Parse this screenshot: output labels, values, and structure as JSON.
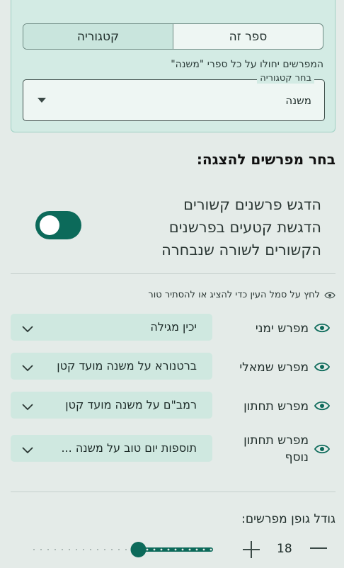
{
  "scope": {
    "segments": [
      "ספר זה",
      "קטגוריה"
    ],
    "active_segment": "קטגוריה",
    "note": "המפרשים יחולו על כל ספרי \"משנה\"",
    "select_label": "בחר קטגוריה",
    "select_value": "משנה"
  },
  "section_title": "בחר מפרשים להצגה:",
  "highlight_toggle": {
    "lines": [
      "הדגש פרשנים קשורים",
      "הדגשת קטעים בפרשנים",
      "הקשורים לשורה שנבחרה"
    ],
    "enabled": true
  },
  "eye_hint": "לחץ על סמל העין כדי להציג או להסתיר טור",
  "commentators": [
    {
      "label": "מפרש ימני",
      "value": "יכין מגילה"
    },
    {
      "label": "מפרש שמאלי",
      "value": "ברטנורא על משנה מועד קטן"
    },
    {
      "label": "מפרש תחתון",
      "value": "רמב\"ם על משנה מועד קטן"
    },
    {
      "label": "מפרש תחתון נוסף",
      "value": "תוספות יום טוב על משנה ..."
    }
  ],
  "font_size": {
    "label": "גודל גופן מפרשים:",
    "value": "18",
    "slider_fraction": 0.59
  },
  "colors": {
    "accent": "#0c6a5a",
    "card": "#d3ebe4",
    "dropdown": "#cfe8e0"
  }
}
